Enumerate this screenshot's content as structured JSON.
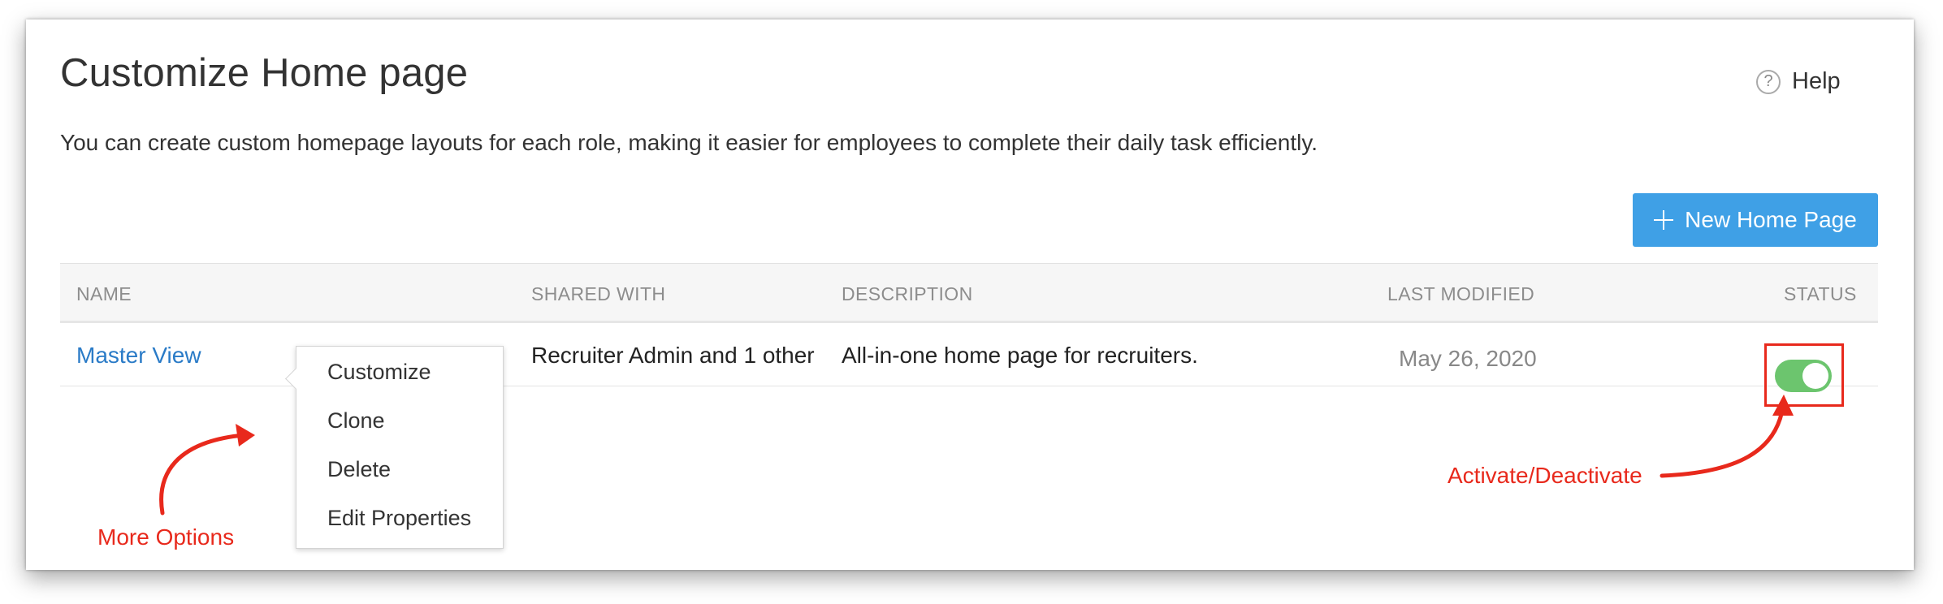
{
  "header": {
    "title": "Customize Home page",
    "subtitle": "You can create custom homepage layouts for each role, making it easier for employees to complete their daily task efficiently.",
    "help_label": "Help",
    "help_icon_glyph": "?",
    "help_icon": "question-circle-icon"
  },
  "toolbar": {
    "new_button_label": "New Home Page",
    "new_button_icon": "plus-icon",
    "accent_color": "#3fa0e6"
  },
  "table": {
    "columns": [
      "NAME",
      "SHARED WITH",
      "DESCRIPTION",
      "LAST MODIFIED",
      "STATUS"
    ],
    "rows": [
      {
        "name": "Master View",
        "shared_with": "Recruiter Admin and 1 other",
        "description": "All-in-one home page for recruiters.",
        "last_modified": "May 26, 2020",
        "status_active": true
      }
    ]
  },
  "context_menu": {
    "items": [
      "Customize",
      "Clone",
      "Delete",
      "Edit Properties"
    ]
  },
  "annotations": {
    "more_options": "More Options",
    "activate_deactivate": "Activate/Deactivate",
    "color": "#e8291c"
  },
  "colors": {
    "link": "#2a7bc7",
    "toggle_on": "#6cc56e"
  }
}
